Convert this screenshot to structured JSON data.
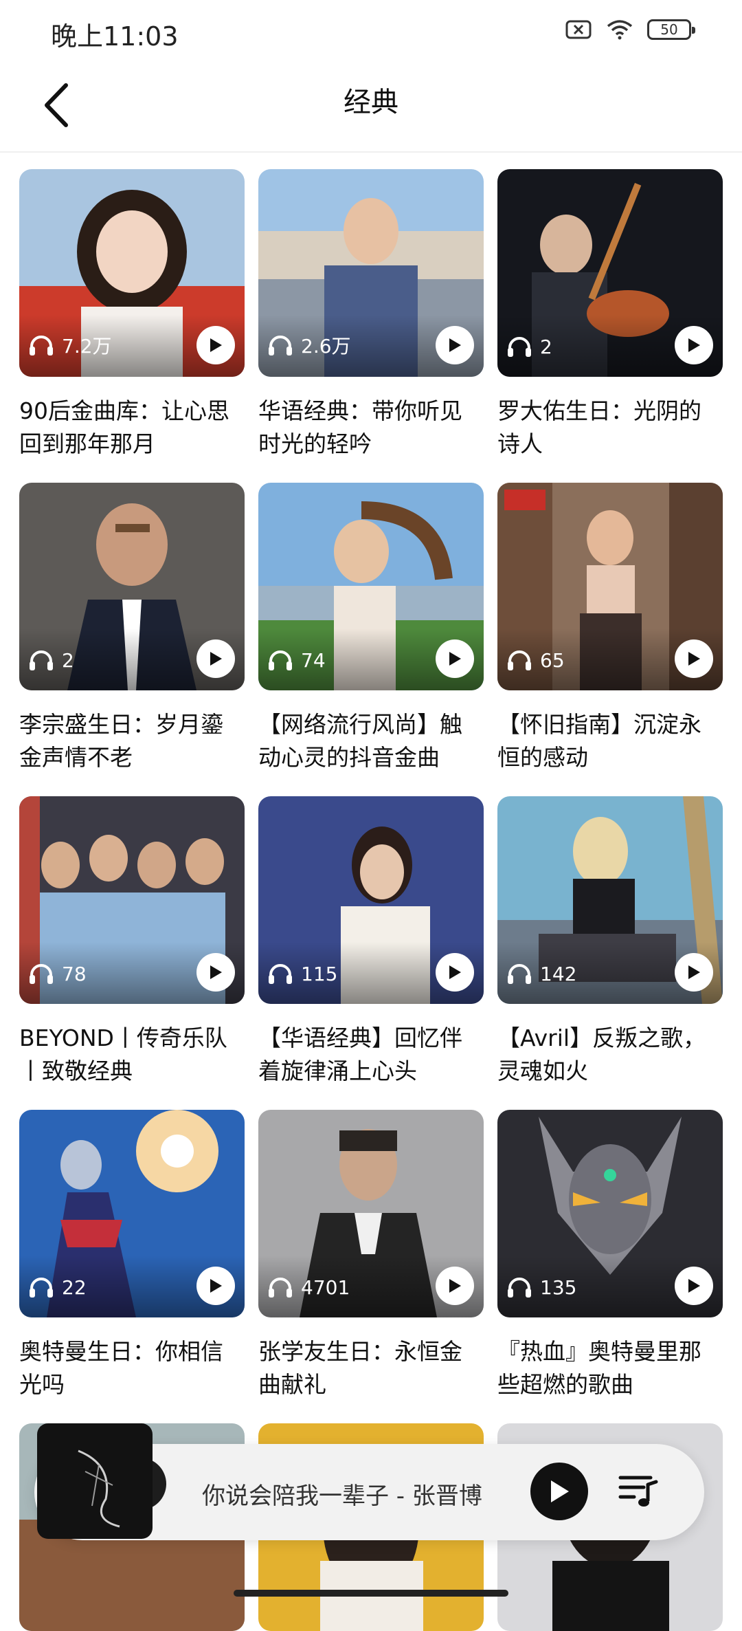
{
  "status_bar": {
    "time": "晚上11:03",
    "battery": "50"
  },
  "header": {
    "title": "经典"
  },
  "cards": [
    {
      "plays": "7.2万",
      "title": "90后金曲库：让心思回到那年那月"
    },
    {
      "plays": "2.6万",
      "title": "华语经典：带你听见时光的轻吟"
    },
    {
      "plays": "2",
      "title": "罗大佑生日：光阴的诗人"
    },
    {
      "plays": "2",
      "title": "李宗盛生日：岁月鎏金声情不老"
    },
    {
      "plays": "74",
      "title": "【网络流行风尚】触动心灵的抖音金曲"
    },
    {
      "plays": "65",
      "title": "【怀旧指南】沉淀永恒的感动"
    },
    {
      "plays": "78",
      "title": "BEYOND丨传奇乐队丨致敬经典"
    },
    {
      "plays": "115",
      "title": "【华语经典】回忆伴着旋律涌上心头"
    },
    {
      "plays": "142",
      "title": "【Avril】反叛之歌，灵魂如火"
    },
    {
      "plays": "22",
      "title": "奥特曼生日：你相信光吗"
    },
    {
      "plays": "4701",
      "title": "张学友生日：永恒金曲献礼"
    },
    {
      "plays": "135",
      "title": "『热血』奥特曼里那些超燃的歌曲"
    }
  ],
  "player": {
    "song": "你说会陪我一辈子 - 张晋博"
  },
  "colors": {
    "accent": "#111111",
    "bar": "#f2f2f2"
  }
}
